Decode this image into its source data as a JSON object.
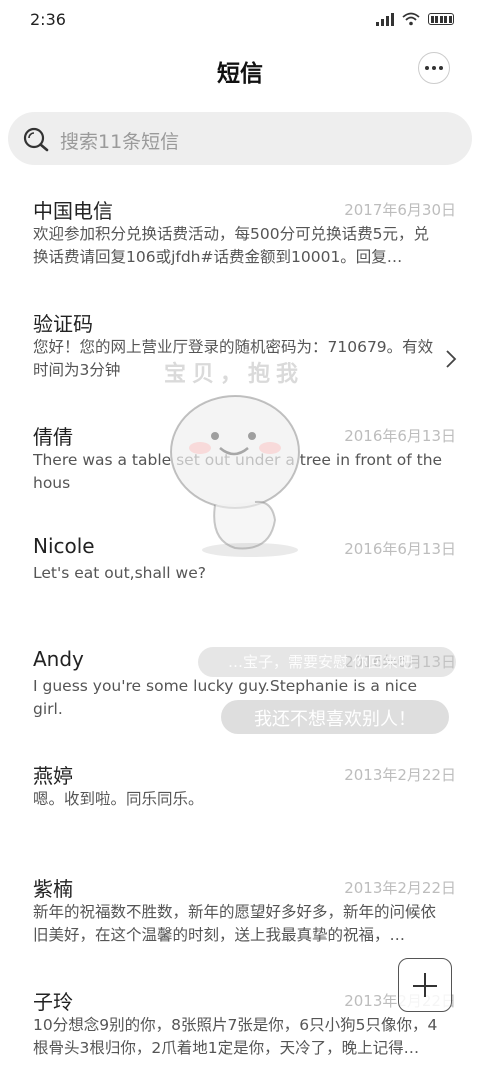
{
  "status_bar": {
    "time": "2:36"
  },
  "header": {
    "title": "短信"
  },
  "search": {
    "placeholder": "搜索11条短信"
  },
  "overlay": {
    "caption": "宝贝，抱我",
    "bubble_top": "…宝子，需要安慰 你回来吧",
    "bubble_bottom": "我还不想喜欢别人！"
  },
  "messages": [
    {
      "name": "中国电信",
      "date": "2017年6月30日",
      "preview": "欢迎参加积分兑换话费活动，每500分可兑换话费5元，兑换话费请回复106或jfdh#话费金额到10001。回复…"
    },
    {
      "name": "验证码",
      "date": "",
      "preview": "您好！您的网上营业厅登录的随机密码为：710679。有效时间为3分钟"
    },
    {
      "name": "倩倩",
      "date": "2016年6月13日",
      "preview": "There was a table set out under a tree in front of the hous"
    },
    {
      "name": "Nicole",
      "date": "2016年6月13日",
      "preview": "Let's eat out,shall we?"
    },
    {
      "name": "Andy",
      "date": "2016年6月13日",
      "preview": "I guess you're some lucky guy.Stephanie is a nice girl."
    },
    {
      "name": "燕婷",
      "date": "2013年2月22日",
      "preview": "嗯。收到啦。同乐同乐。"
    },
    {
      "name": "紫楠",
      "date": "2013年2月22日",
      "preview": "新年的祝福数不胜数，新年的愿望好多好多，新年的问候依旧美好，在这个温馨的时刻，送上我最真挚的祝福，…"
    },
    {
      "name": "子玲",
      "date": "2013年2月22日",
      "preview": "10分想念9别的你，8张照片7张是你，6只小狗5只像你，4根骨头3根归你，2爪着地1定是你，天冷了，晚上记得…"
    }
  ],
  "icons": {
    "search": "search-icon",
    "more": "more-dots-icon",
    "chevron": "chevron-right-icon",
    "compose": "plus-icon"
  }
}
